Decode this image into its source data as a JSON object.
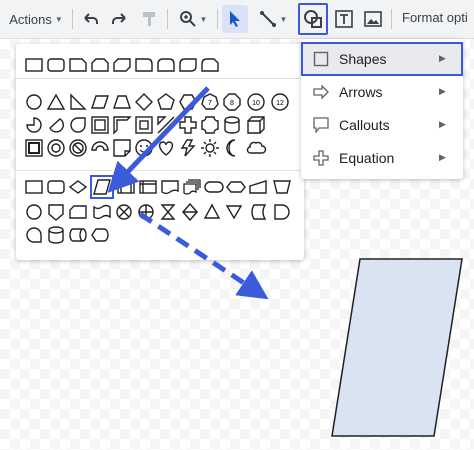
{
  "toolbar": {
    "actions_label": "Actions",
    "format_options_label": "Format opti",
    "icons": [
      "undo-icon",
      "redo-icon",
      "paint-format-icon",
      "zoom-icon",
      "select-icon",
      "line-icon",
      "shape-icon",
      "text-box-icon",
      "image-icon"
    ]
  },
  "shape_menu": {
    "items": [
      {
        "label": "Shapes",
        "icon": "square-icon",
        "has_submenu": true,
        "active": true
      },
      {
        "label": "Arrows",
        "icon": "arrow-icon",
        "has_submenu": true
      },
      {
        "label": "Callouts",
        "icon": "callout-icon",
        "has_submenu": true
      },
      {
        "label": "Equation",
        "icon": "plus-icon",
        "has_submenu": true
      }
    ]
  },
  "shape_grid": {
    "rows": [
      {
        "section": "basic",
        "shapes": [
          "rectangle",
          "rounded-rectangle",
          "snip-single-corner",
          "snip-same-side",
          "snip-diagonal",
          "round-single-corner",
          "round-same-side",
          "round-diagonal",
          "snip-round"
        ]
      },
      {
        "section": "shapes",
        "shapes": [
          "oval",
          "triangle",
          "right-triangle",
          "parallelogram",
          "trapezoid",
          "diamond",
          "pentagon",
          "hexagon",
          "heptagon",
          "octagon",
          "decagon",
          "dodecagon"
        ]
      },
      {
        "section": "shapes",
        "shapes": [
          "pie",
          "chord",
          "teardrop",
          "frame",
          "half-frame",
          "l-shape",
          "diagonal-stripe",
          "plus",
          "plaque",
          "can",
          "cube"
        ]
      },
      {
        "section": "shapes",
        "shapes": [
          "bevel",
          "donut",
          "no-symbol",
          "block-arc",
          "folded-corner",
          "smiley",
          "heart",
          "lightning",
          "sun",
          "moon",
          "cloud"
        ]
      },
      {
        "section": "flowchart",
        "shapes": [
          "process",
          "alternate-process",
          "decision",
          "data",
          "predefined-process",
          "internal-storage",
          "document",
          "multidocument",
          "terminator",
          "preparation",
          "manual-input",
          "manual-operation"
        ]
      },
      {
        "section": "flowchart",
        "shapes": [
          "connector",
          "offpage-connector",
          "card",
          "punched-tape",
          "summing-junction",
          "or",
          "collate",
          "sort",
          "extract",
          "merge",
          "stored-data",
          "delay"
        ]
      },
      {
        "section": "flowchart",
        "shapes": [
          "sequential-access",
          "magnetic-disk",
          "direct-access",
          "display"
        ]
      }
    ],
    "highlighted_shape": "data"
  },
  "colors": {
    "accent": "#3a5ad9",
    "arrow": "#3b5bdb",
    "shape_fill": "#dae3f2",
    "shape_stroke": "#202124"
  }
}
